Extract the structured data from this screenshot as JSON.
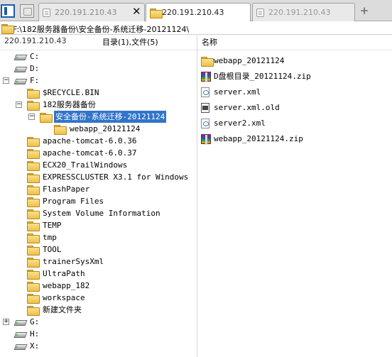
{
  "tabs": [
    {
      "label": "220.191.210.43",
      "icon": "document-icon",
      "active": false
    },
    {
      "label": "220.191.210.43",
      "icon": "folder-icon",
      "active": true
    },
    {
      "label": "220.191.210.43",
      "icon": "document-icon",
      "active": false
    }
  ],
  "tab_close_glyph": "✕",
  "tab_add_glyph": "+",
  "path": "F:\\182服务器备份\\安全备份-系统迁移-20121124\\",
  "header": {
    "address": "220.191.210.43",
    "counts": "目录(1),文件(5)",
    "name_col": "名称"
  },
  "tree": [
    {
      "label": "C:",
      "type": "drive",
      "expand": ""
    },
    {
      "label": "D:",
      "type": "drive",
      "expand": ""
    },
    {
      "label": "F:",
      "type": "drive",
      "expand": "−"
    },
    {
      "label": "$RECYCLE.BIN",
      "type": "folder",
      "expand": ""
    },
    {
      "label": "182服务器备份",
      "type": "folder",
      "expand": "−"
    },
    {
      "label": "安全备份-系统迁移-20121124",
      "type": "folder-open",
      "expand": "−",
      "selected": true
    },
    {
      "label": "webapp_20121124",
      "type": "folder",
      "expand": ""
    },
    {
      "label": "apache-tomcat-6.0.36",
      "type": "folder",
      "expand": ""
    },
    {
      "label": "apache-tomcat-6.0.37",
      "type": "folder",
      "expand": ""
    },
    {
      "label": "ECX20_TrailWindows",
      "type": "folder",
      "expand": ""
    },
    {
      "label": "EXPRESSCLUSTER X3.1 for Windows",
      "type": "folder",
      "expand": ""
    },
    {
      "label": "FlashPaper",
      "type": "folder",
      "expand": ""
    },
    {
      "label": "Program Files",
      "type": "folder",
      "expand": ""
    },
    {
      "label": "System Volume Information",
      "type": "folder",
      "expand": ""
    },
    {
      "label": "TEMP",
      "type": "folder",
      "expand": ""
    },
    {
      "label": "tmp",
      "type": "folder",
      "expand": ""
    },
    {
      "label": "TOOL",
      "type": "folder",
      "expand": ""
    },
    {
      "label": "trainerSysXml",
      "type": "folder",
      "expand": ""
    },
    {
      "label": "UltraPath",
      "type": "folder",
      "expand": ""
    },
    {
      "label": "webapp_182",
      "type": "folder",
      "expand": ""
    },
    {
      "label": "workspace",
      "type": "folder",
      "expand": ""
    },
    {
      "label": "新建文件夹",
      "type": "folder",
      "expand": ""
    },
    {
      "label": "G:",
      "type": "drive",
      "expand": "+"
    },
    {
      "label": "H:",
      "type": "drive",
      "expand": ""
    },
    {
      "label": "X:",
      "type": "drive",
      "expand": ""
    }
  ],
  "files": [
    {
      "label": "webapp_20121124",
      "type": "folder"
    },
    {
      "label": "D盘根目录_20121124.zip",
      "type": "zip"
    },
    {
      "label": "server.xml",
      "type": "xml"
    },
    {
      "label": "server.xml.old",
      "type": "old"
    },
    {
      "label": "server2.xml",
      "type": "xml"
    },
    {
      "label": "webapp_20121124.zip",
      "type": "zip"
    }
  ]
}
